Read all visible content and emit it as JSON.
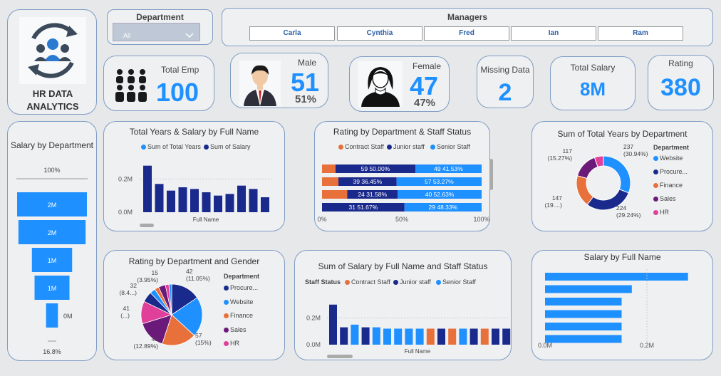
{
  "logo": {
    "line1": "HR DATA",
    "line2": "ANALYTICS"
  },
  "filters": {
    "department_title": "Department",
    "department_value": "All",
    "managers_title": "Managers",
    "managers": [
      "Carla",
      "Cynthia",
      "Fred",
      "Ian",
      "Ram"
    ]
  },
  "kpis": {
    "total_emp": {
      "label": "Total Emp",
      "value": "100"
    },
    "male": {
      "label": "Male",
      "value": "51",
      "pct": "51%"
    },
    "female": {
      "label": "Female",
      "value": "47",
      "pct": "47%"
    },
    "missing": {
      "label": "Missing Data",
      "value": "2"
    },
    "total_salary": {
      "label": "Total Salary",
      "value": "8M"
    },
    "rating": {
      "label": "Rating",
      "value": "380"
    }
  },
  "colors": {
    "navy": "#1a2a8c",
    "blue": "#1e90ff",
    "orange": "#e8703a",
    "purple": "#6b1a7a",
    "pink": "#e0409a"
  },
  "chart_data": [
    {
      "id": "salary_by_department",
      "type": "funnel",
      "title": "Salary by Department",
      "top_label": "100%",
      "bottom_label": "16.8%",
      "categories": [
        "",
        "",
        "",
        "",
        ""
      ],
      "values": [
        2.36,
        2.27,
        1.36,
        1.18,
        0.4
      ],
      "labels": [
        "2M",
        "2M",
        "1M",
        "1M",
        "0M"
      ]
    },
    {
      "id": "total_years_salary",
      "type": "bar",
      "title": "Total Years & Salary by Full Name",
      "legend": [
        "Sum of Total Years",
        "Sum of Salary"
      ],
      "xlabel": "Full Name",
      "y_ticks": [
        "0.2M",
        "0.0M"
      ],
      "ylim": [
        0,
        0.3
      ],
      "values": [
        0.28,
        0.17,
        0.13,
        0.15,
        0.14,
        0.12,
        0.1,
        0.11,
        0.16,
        0.14,
        0.09
      ]
    },
    {
      "id": "rating_by_dept_status",
      "type": "stacked_bar_100",
      "title": "Rating by Department & Staff Status",
      "legend": [
        "Contract Staff",
        "Junior staff",
        "Senior Staff"
      ],
      "x_ticks": [
        "0%",
        "50%",
        "100%"
      ],
      "rows": [
        {
          "contract": 8.47,
          "junior": 50.0,
          "senior": 41.53,
          "junior_label": "59 50.00%",
          "senior_label": "49 41.53%"
        },
        {
          "contract": 10.28,
          "junior": 36.45,
          "senior": 53.27,
          "junior_label": "39 36.45%",
          "senior_label": "57 53.27%"
        },
        {
          "contract": 15.79,
          "junior": 31.58,
          "senior": 52.63,
          "junior_label": "24 31.58%",
          "senior_label": "40 52.63%"
        },
        {
          "contract": 0,
          "junior": 51.67,
          "senior": 48.33,
          "junior_label": "31 51.67%",
          "senior_label": "29 48.33%"
        }
      ]
    },
    {
      "id": "total_years_by_department",
      "type": "donut",
      "title": "Sum of Total Years by Department",
      "legend_title": "Department",
      "legend": [
        "Website",
        "Procure...",
        "Finance",
        "Sales",
        "HR"
      ],
      "values": [
        237,
        224,
        147,
        117,
        41
      ],
      "labels": [
        {
          "value": "237",
          "pct": "(30.94%)"
        },
        {
          "value": "224",
          "pct": "(29.24%)"
        },
        {
          "value": "147",
          "pct": "(19....)"
        },
        {
          "value": "117",
          "pct": "(15.27%)"
        }
      ]
    },
    {
      "id": "rating_by_dept_gender",
      "type": "pie",
      "title": "Rating by Department and Gender",
      "legend_title": "Department",
      "legend": [
        "Procure...",
        "Website",
        "Finance",
        "Sales",
        "HR"
      ],
      "values": [
        42,
        57,
        49,
        41,
        32,
        15,
        8,
        6,
        10,
        5,
        4
      ],
      "labels": [
        {
          "value": "42",
          "pct": "(11.05%)"
        },
        {
          "value": "57",
          "pct": "(15%)"
        },
        {
          "value": "49",
          "pct": "(12.89%)"
        },
        {
          "value": "41",
          "pct": "(...)"
        },
        {
          "value": "32",
          "pct": "(8.4...)"
        },
        {
          "value": "15",
          "pct": "(3.95%)"
        }
      ]
    },
    {
      "id": "salary_by_name_status",
      "type": "bar",
      "title": "Sum of Salary by Full Name and Staff Status",
      "legend_title": "Staff Status",
      "legend": [
        "Contract Staff",
        "Junior staff",
        "Senior Staff"
      ],
      "xlabel": "Full Name",
      "y_ticks": [
        "0.2M",
        "0.0M"
      ],
      "ylim": [
        0,
        0.32
      ],
      "values": [
        0.3,
        0.13,
        0.15,
        0.13,
        0.13,
        0.12,
        0.12,
        0.12,
        0.12,
        0.12,
        0.12,
        0.12,
        0.12,
        0.12,
        0.12,
        0.12,
        0.12
      ],
      "status": [
        "navy",
        "navy",
        "blue",
        "navy",
        "blue",
        "blue",
        "blue",
        "blue",
        "blue",
        "orange",
        "navy",
        "orange",
        "blue",
        "navy",
        "orange",
        "navy",
        "navy"
      ]
    },
    {
      "id": "salary_by_full_name",
      "type": "hbar",
      "title": "Salary by Full Name",
      "x_ticks": [
        "0.0M",
        "0.2M"
      ],
      "xlim": [
        0,
        0.3
      ],
      "values": [
        0.28,
        0.17,
        0.15,
        0.15,
        0.15,
        0.15
      ]
    }
  ]
}
